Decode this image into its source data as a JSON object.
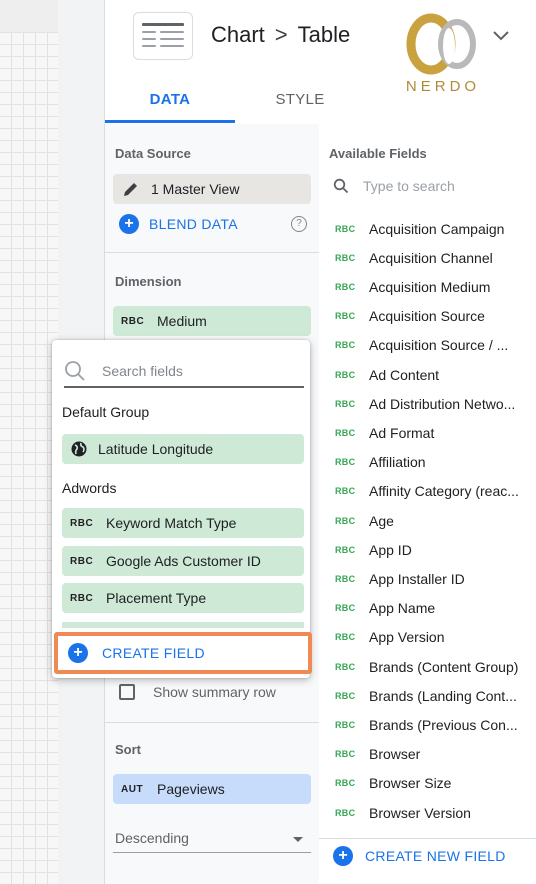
{
  "header": {
    "chart_label": "Chart",
    "separator": ">",
    "type_label": "Table",
    "logo_text": "NERDO"
  },
  "tabs": [
    {
      "label": "DATA",
      "active": true
    },
    {
      "label": "STYLE",
      "active": false
    }
  ],
  "data_source": {
    "label": "Data Source",
    "name": "1 Master View",
    "blend_label": "BLEND DATA",
    "help_glyph": "?"
  },
  "dimension": {
    "label": "Dimension",
    "type": "RBC",
    "field": "Medium"
  },
  "summary_row_label": "Show summary row",
  "sort": {
    "label": "Sort",
    "type": "AUT",
    "field": "Pageviews",
    "order": "Descending"
  },
  "available_fields": {
    "title": "Available Fields",
    "search_placeholder": "Type to search",
    "fields": [
      {
        "type": "RBC",
        "name": "Acquisition Campaign"
      },
      {
        "type": "RBC",
        "name": "Acquisition Channel"
      },
      {
        "type": "RBC",
        "name": "Acquisition Medium"
      },
      {
        "type": "RBC",
        "name": "Acquisition Source"
      },
      {
        "type": "RBC",
        "name": "Acquisition Source / ..."
      },
      {
        "type": "RBC",
        "name": "Ad Content"
      },
      {
        "type": "RBC",
        "name": "Ad Distribution Netwo..."
      },
      {
        "type": "RBC",
        "name": "Ad Format"
      },
      {
        "type": "RBC",
        "name": "Affiliation"
      },
      {
        "type": "RBC",
        "name": "Affinity Category (reac..."
      },
      {
        "type": "RBC",
        "name": "Age"
      },
      {
        "type": "RBC",
        "name": "App ID"
      },
      {
        "type": "RBC",
        "name": "App Installer ID"
      },
      {
        "type": "RBC",
        "name": "App Name"
      },
      {
        "type": "RBC",
        "name": "App Version"
      },
      {
        "type": "RBC",
        "name": "Brands (Content Group)"
      },
      {
        "type": "RBC",
        "name": "Brands (Landing Cont..."
      },
      {
        "type": "RBC",
        "name": "Brands (Previous Con..."
      },
      {
        "type": "RBC",
        "name": "Browser"
      },
      {
        "type": "RBC",
        "name": "Browser Size"
      },
      {
        "type": "RBC",
        "name": "Browser Version"
      }
    ],
    "create_new_label": "CREATE NEW FIELD"
  },
  "popup": {
    "search_placeholder": "Search fields",
    "default_group_label": "Default Group",
    "default_fields": [
      {
        "name": "Latitude Longitude"
      }
    ],
    "adwords_label": "Adwords",
    "adwords_fields": [
      {
        "type": "RBC",
        "name": "Keyword Match Type"
      },
      {
        "type": "RBC",
        "name": "Google Ads Customer ID"
      },
      {
        "type": "RBC",
        "name": "Placement Type"
      }
    ],
    "create_field_label": "CREATE FIELD",
    "plus_glyph": "+"
  },
  "colors": {
    "accent": "#1a73e8",
    "dimension_green": "#ceead6",
    "metric_blue": "#c6dcfa",
    "highlight_orange": "#ef8a55"
  }
}
